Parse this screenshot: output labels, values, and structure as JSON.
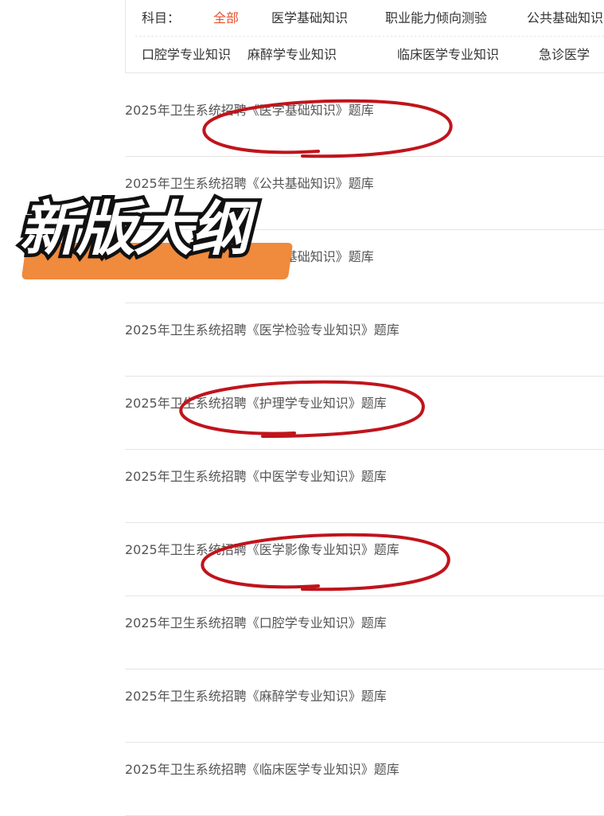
{
  "filter": {
    "label": "科目：",
    "row1": [
      {
        "label": "全部",
        "active": true
      },
      {
        "label": "医学基础知识",
        "active": false
      },
      {
        "label": "职业能力倾向测验",
        "active": false
      },
      {
        "label": "公共基础知识",
        "active": false
      }
    ],
    "row2": [
      {
        "label": "口腔学专业知识"
      },
      {
        "label": "麻醉学专业知识"
      },
      {
        "label": "临床医学专业知识"
      },
      {
        "label": "急诊医学"
      }
    ]
  },
  "items": [
    {
      "title": "2025年卫生系统招聘《医学基础知识》题库",
      "circled": true
    },
    {
      "title": "2025年卫生系统招聘《公共基础知识》题库",
      "circled": false
    },
    {
      "title": "2025年卫生系统招聘《综合基础知识》题库",
      "circled": false
    },
    {
      "title": "2025年卫生系统招聘《医学检验专业知识》题库",
      "circled": false
    },
    {
      "title": "2025年卫生系统招聘《护理学专业知识》题库",
      "circled": true
    },
    {
      "title": "2025年卫生系统招聘《中医学专业知识》题库",
      "circled": false
    },
    {
      "title": "2025年卫生系统招聘《医学影像专业知识》题库",
      "circled": true
    },
    {
      "title": "2025年卫生系统招聘《口腔学专业知识》题库",
      "circled": false
    },
    {
      "title": "2025年卫生系统招聘《麻醉学专业知识》题库",
      "circled": false
    },
    {
      "title": "2025年卫生系统招聘《临床医学专业知识》题库",
      "circled": false
    }
  ],
  "banner": {
    "text": "新版大纲",
    "highlight_color": "#f08a3c"
  },
  "colors": {
    "active": "#e8522c",
    "circle": "#c0141c"
  }
}
